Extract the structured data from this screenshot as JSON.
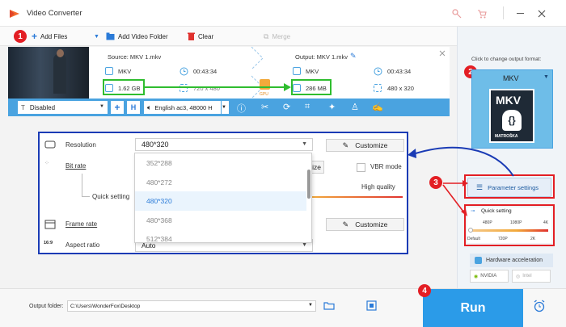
{
  "titlebar": {
    "title": "Video Converter"
  },
  "toolbar": {
    "add_files": "Add Files",
    "add_video_folder": "Add Video Folder",
    "clear": "Clear",
    "merge": "Merge"
  },
  "file": {
    "source_label": "Source: MKV 1.mkv",
    "output_label": "Output: MKV 1.mkv",
    "source_format": "MKV",
    "source_duration": "00:43:34",
    "source_size": "1.62 GB",
    "source_resolution": "720 x 480",
    "output_format": "MKV",
    "output_duration": "00:43:34",
    "output_size": "286 MB",
    "output_resolution": "480 x 320",
    "gpu_label": "GPU"
  },
  "editbar": {
    "subtitle_select": "Disabled",
    "audio_select": "English ac3, 48000 H"
  },
  "popup": {
    "resolution_label": "Resolution",
    "resolution_value": "480*320",
    "bitrate_label": "Bit rate",
    "quick_setting_label": "Quick setting",
    "high_quality_label": "High quality",
    "vbr_label": "VBR mode",
    "frame_rate_label": "Frame rate",
    "aspect_ratio_label": "Aspect ratio",
    "aspect_ratio_value": "Auto",
    "customize_1": "Customize",
    "customize_2": "Customize",
    "customize_partial": "ize",
    "aspect_icon_text": "16:9"
  },
  "dropdown": {
    "options": [
      "352*288",
      "480*272",
      "480*320",
      "480*368",
      "512*384"
    ],
    "selected_index": 2
  },
  "right_panel": {
    "click_label": "Click to change output format:",
    "format_name": "MKV",
    "logo_text": "MKV",
    "logo_subtext": "MATROŠKA",
    "parameter_settings": "Parameter settings",
    "quick_setting": "Quick setting",
    "quality_ticks_top": [
      "480P",
      "1080P",
      "4K"
    ],
    "quality_ticks_bottom": [
      "Default",
      "720P",
      "2K"
    ],
    "hardware_acceleration": "Hardware acceleration",
    "nvidia": "NVIDIA",
    "intel": "Intel"
  },
  "bottom": {
    "output_folder_label": "Output folder:",
    "output_folder_value": "C:\\Users\\WonderFox\\Desktop",
    "run_label": "Run"
  },
  "badges": [
    "1",
    "2",
    "3",
    "4"
  ],
  "colors": {
    "accent_blue": "#4aa3e0",
    "run_blue": "#2b9be8",
    "badge_red": "#e31e24",
    "highlight_green": "#2fbd2f",
    "popup_border": "#1a3bb5"
  }
}
